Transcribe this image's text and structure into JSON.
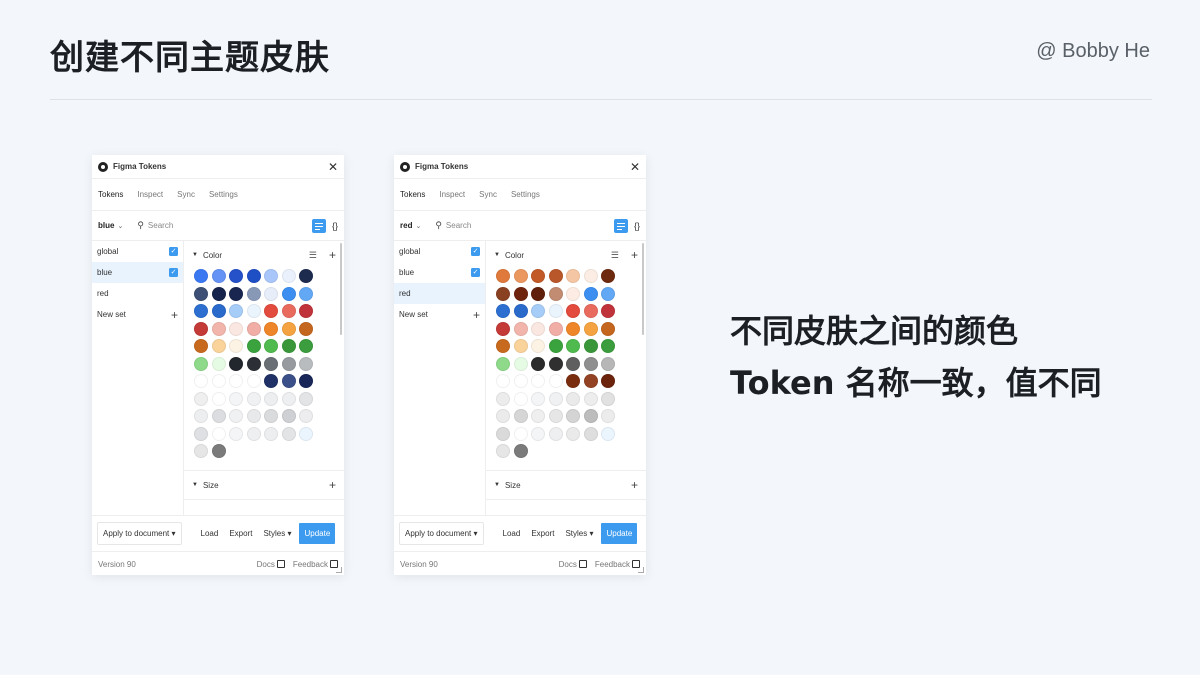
{
  "slide": {
    "title": "创建不同主题皮肤",
    "author": "@ Bobby He",
    "caption_line1": "不同皮肤之间的颜色",
    "caption_line2": "Token 名称一致，值不同"
  },
  "plugins": [
    {
      "window_title": "Figma Tokens",
      "tabs": [
        "Tokens",
        "Inspect",
        "Sync",
        "Settings"
      ],
      "active_tab": "Tokens",
      "selected_set": "blue",
      "search_placeholder": "Search",
      "json_label": "{}",
      "sets": [
        {
          "name": "global",
          "checked": true,
          "selected": false
        },
        {
          "name": "blue",
          "checked": true,
          "selected": true
        },
        {
          "name": "red",
          "checked": false,
          "selected": false
        }
      ],
      "new_set_label": "New set",
      "color_section_label": "Color",
      "size_section_label": "Size",
      "swatches": [
        "#3a78f2",
        "#6493f5",
        "#2551c9",
        "#1f4fc4",
        "#a9c6fb",
        "#eaf1fd",
        "#1d2b4f",
        "#3d4f74",
        "#16244d",
        "#182650",
        "#8899b8",
        "#e7edf9",
        "#3c8ff0",
        "#63a8f5",
        "#2c6fd0",
        "#2a6acb",
        "#a6cdf7",
        "#eaf4fd",
        "#e24b3d",
        "#e86b5e",
        "#c0333a",
        "#c33a37",
        "#f2b5ab",
        "#fbe7e1",
        "#f0aea6",
        "#ef8529",
        "#f4a340",
        "#c4661e",
        "#c86a1e",
        "#fad39b",
        "#fdf3e4",
        "#3ba33e",
        "#4fba4e",
        "#39973a",
        "#3b9d3d",
        "#8ed98a",
        "#e6fbe4",
        "#22262d",
        "#2c3036",
        "#6a6e75",
        "#979ba0",
        "#b9bcbf",
        "#ffffff",
        "#ffffff",
        "#ffffff",
        "#ffffff",
        "#1f3166",
        "#3b5088",
        "#182658",
        "#efeff0",
        "#ffffff",
        "#f4f5f7",
        "#f0f1f3",
        "#eceef0",
        "#eeeff1",
        "#e3e4e6",
        "#eceef0",
        "#dcdde0",
        "#f0f1f3",
        "#e8e9eb",
        "#dadbdd",
        "#cfd0d3",
        "#ededef",
        "#dfe0e3",
        "#ffffff",
        "#f4f5f7",
        "#eeeff1",
        "#eceef0",
        "#e3e4e6",
        "#eaf5fe",
        "#e6e6e7",
        "#7b7b7b"
      ],
      "actions": {
        "apply": "Apply to document",
        "load": "Load",
        "export": "Export",
        "styles": "Styles",
        "update": "Update"
      },
      "version": "Version 90",
      "docs": "Docs",
      "feedback": "Feedback"
    },
    {
      "window_title": "Figma Tokens",
      "tabs": [
        "Tokens",
        "Inspect",
        "Sync",
        "Settings"
      ],
      "active_tab": "Tokens",
      "selected_set": "red",
      "search_placeholder": "Search",
      "json_label": "{}",
      "sets": [
        {
          "name": "global",
          "checked": true,
          "selected": false
        },
        {
          "name": "blue",
          "checked": true,
          "selected": false
        },
        {
          "name": "red",
          "checked": false,
          "selected": true
        }
      ],
      "new_set_label": "New set",
      "color_section_label": "Color",
      "size_section_label": "Size",
      "swatches": [
        "#e07a3c",
        "#eb9760",
        "#c25a27",
        "#b9572a",
        "#f5c6a3",
        "#fbede3",
        "#6e2a0f",
        "#8a4122",
        "#6e230c",
        "#5f1f0b",
        "#c28c72",
        "#fcece3",
        "#3c8ff0",
        "#63a8f5",
        "#2c6fd0",
        "#2a6acb",
        "#a6cdf7",
        "#eaf4fd",
        "#e24b3d",
        "#e86b5e",
        "#c0333a",
        "#c33a37",
        "#f2b5ab",
        "#fbe7e1",
        "#f0aea6",
        "#ef8529",
        "#f4a340",
        "#c4661e",
        "#c86a1e",
        "#fad39b",
        "#fdf3e4",
        "#3ba33e",
        "#4fba4e",
        "#39973a",
        "#3b9d3d",
        "#8ed98a",
        "#e6fbe4",
        "#2b2b2b",
        "#303030",
        "#5f5f5f",
        "#8f8f8f",
        "#b7b7b7",
        "#ffffff",
        "#ffffff",
        "#ffffff",
        "#ffffff",
        "#7a2d0e",
        "#934324",
        "#6b230c",
        "#ececec",
        "#ffffff",
        "#f4f5f7",
        "#f0f1f3",
        "#eaeaea",
        "#ededed",
        "#e1e1e1",
        "#ebebeb",
        "#d6d6d6",
        "#efefef",
        "#e6e6e6",
        "#d4d4d4",
        "#bdbdbd",
        "#ececec",
        "#dadada",
        "#ffffff",
        "#f4f5f7",
        "#eeeff1",
        "#eaeaea",
        "#dedede",
        "#eaf5fe",
        "#e6e6e7",
        "#7b7b7b"
      ],
      "actions": {
        "apply": "Apply to document",
        "load": "Load",
        "export": "Export",
        "styles": "Styles",
        "update": "Update"
      },
      "version": "Version 90",
      "docs": "Docs",
      "feedback": "Feedback"
    }
  ]
}
